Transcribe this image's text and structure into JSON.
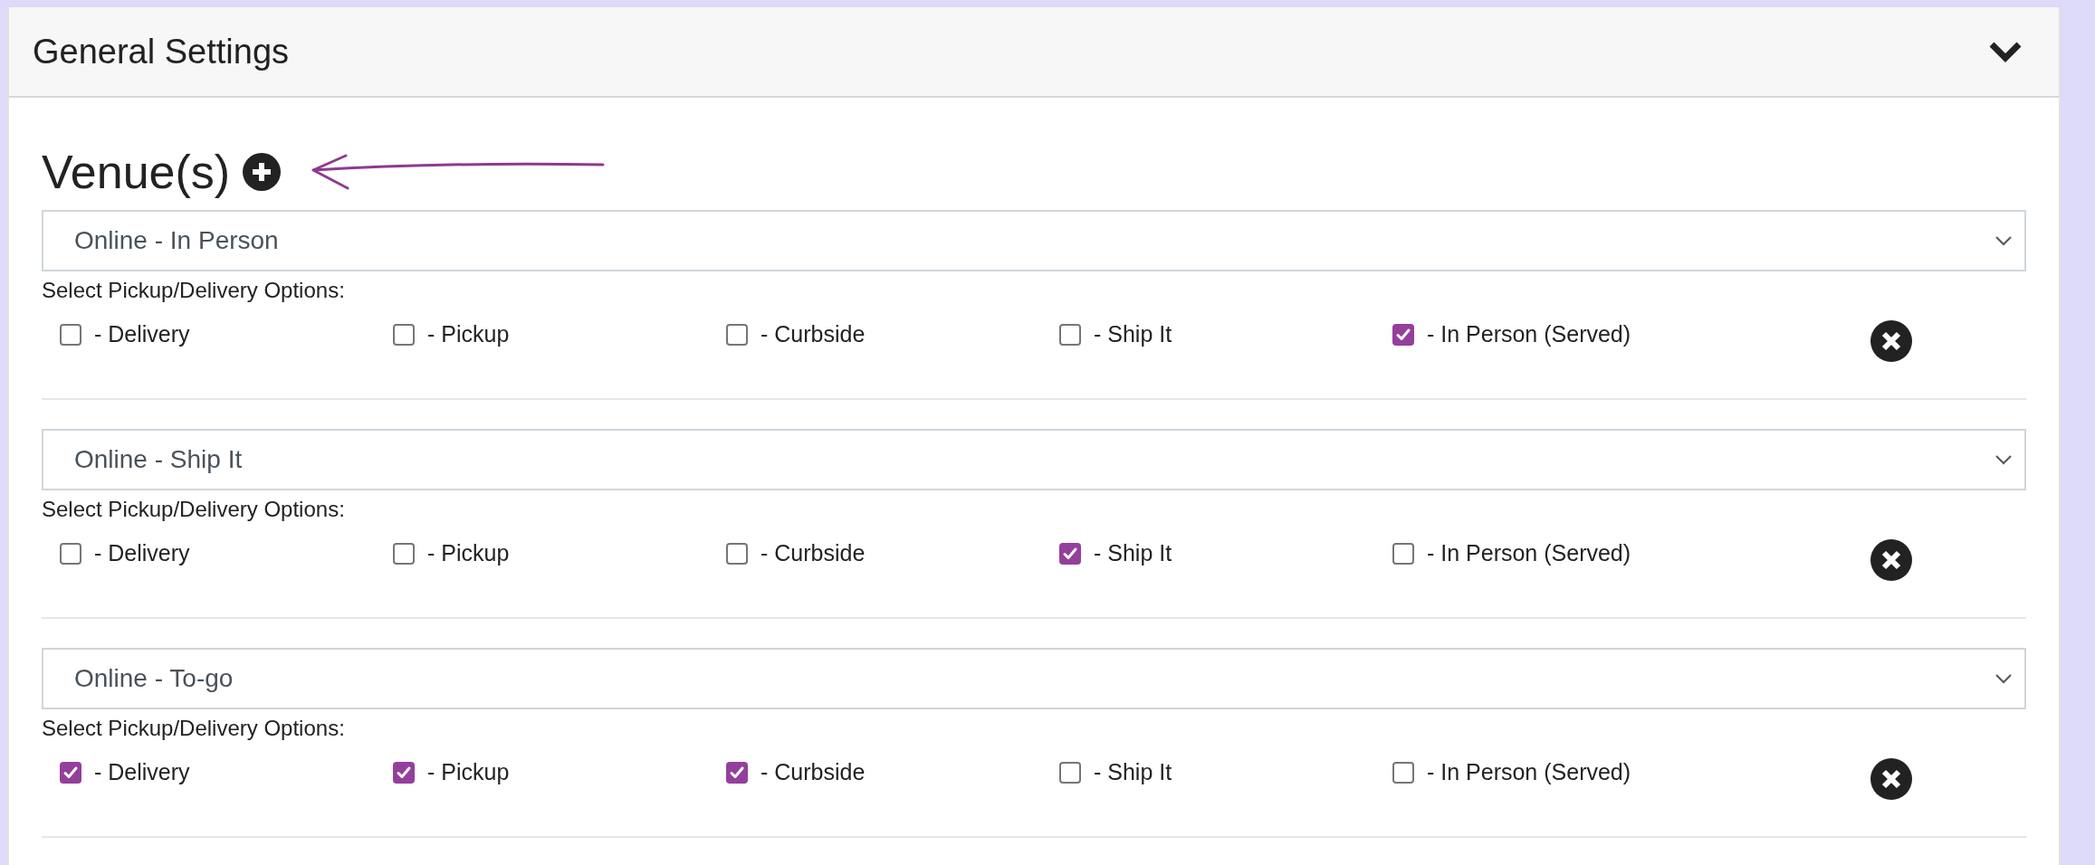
{
  "panel": {
    "title": "General Settings",
    "expanded": true
  },
  "venues_heading": "Venue(s)",
  "venues": [
    {
      "venue": "Online - In Person",
      "options_label": "Select Pickup/Delivery Options:",
      "options": [
        {
          "label": "- Delivery",
          "checked": false
        },
        {
          "label": "- Pickup",
          "checked": false
        },
        {
          "label": "- Curbside",
          "checked": false
        },
        {
          "label": "- Ship It",
          "checked": false
        },
        {
          "label": "- In Person (Served)",
          "checked": true
        }
      ]
    },
    {
      "venue": "Online - Ship It",
      "options_label": "Select Pickup/Delivery Options:",
      "options": [
        {
          "label": "- Delivery",
          "checked": false
        },
        {
          "label": "- Pickup",
          "checked": false
        },
        {
          "label": "- Curbside",
          "checked": false
        },
        {
          "label": "- Ship It",
          "checked": true
        },
        {
          "label": "- In Person (Served)",
          "checked": false
        }
      ]
    },
    {
      "venue": "Online - To-go",
      "options_label": "Select Pickup/Delivery Options:",
      "options": [
        {
          "label": "- Delivery",
          "checked": true
        },
        {
          "label": "- Pickup",
          "checked": true
        },
        {
          "label": "- Curbside",
          "checked": true
        },
        {
          "label": "- Ship It",
          "checked": false
        },
        {
          "label": "- In Person (Served)",
          "checked": false
        }
      ]
    }
  ]
}
